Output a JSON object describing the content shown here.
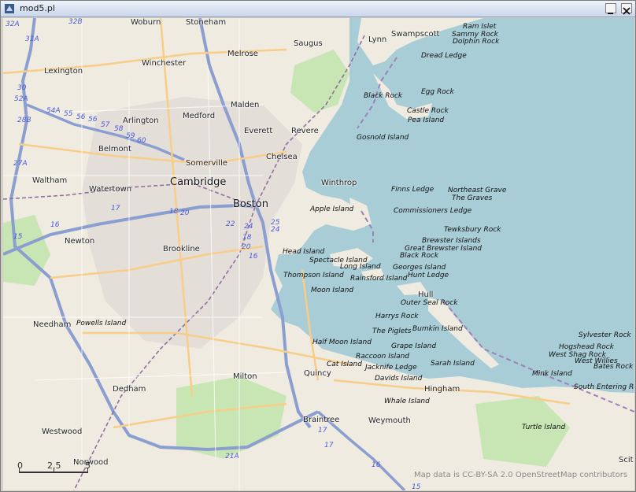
{
  "window": {
    "title": "mod5.pl"
  },
  "map": {
    "colors": {
      "water": "#a9cdd6",
      "land": "#efebe0",
      "urban": "#e2ddd8",
      "park": "#c8e6b4",
      "road": "#f7cd87",
      "highway": "#8b9ed0",
      "rail": "#8f6fa0"
    },
    "towns": [
      {
        "label": "Woburn"
      },
      {
        "label": "Stoneham"
      },
      {
        "label": "Lexington"
      },
      {
        "label": "Winchester"
      },
      {
        "label": "Melrose"
      },
      {
        "label": "Saugus"
      },
      {
        "label": "Lynn"
      },
      {
        "label": "Swampscott"
      },
      {
        "label": "Malden"
      },
      {
        "label": "Medford"
      },
      {
        "label": "Arlington"
      },
      {
        "label": "Everett"
      },
      {
        "label": "Revere"
      },
      {
        "label": "Belmont"
      },
      {
        "label": "Chelsea"
      },
      {
        "label": "Somerville"
      },
      {
        "label": "Waltham"
      },
      {
        "label": "Watertown"
      },
      {
        "label": "Winthrop"
      },
      {
        "label": "Newton"
      },
      {
        "label": "Brookline"
      },
      {
        "label": "Needham"
      },
      {
        "label": "Milton"
      },
      {
        "label": "Quincy"
      },
      {
        "label": "Hull"
      },
      {
        "label": "Dedham"
      },
      {
        "label": "Hingham"
      },
      {
        "label": "Braintree"
      },
      {
        "label": "Weymouth"
      },
      {
        "label": "Westwood"
      },
      {
        "label": "Norwood"
      },
      {
        "label": "Scit"
      }
    ],
    "major_towns": [
      {
        "label": "Cambridge"
      },
      {
        "label": "Boston"
      }
    ],
    "water_features": [
      {
        "label": "Ram Islet"
      },
      {
        "label": "Sammy Rock"
      },
      {
        "label": "Dolphin Rock"
      },
      {
        "label": "Dread Ledge"
      },
      {
        "label": "Egg Rock"
      },
      {
        "label": "Black Rock"
      },
      {
        "label": "Castle Rock"
      },
      {
        "label": "Pea Island"
      },
      {
        "label": "Gosnold Island"
      },
      {
        "label": "Finns Ledge"
      },
      {
        "label": "Northeast Grave"
      },
      {
        "label": "The Graves"
      },
      {
        "label": "Apple Island"
      },
      {
        "label": "Commissioners Ledge"
      },
      {
        "label": "Tewksbury Rock"
      },
      {
        "label": "Brewster Islands"
      },
      {
        "label": "Great Brewster Island"
      },
      {
        "label": "Head Island"
      },
      {
        "label": "Black Rock"
      },
      {
        "label": "Spectacle Island"
      },
      {
        "label": "Long Island"
      },
      {
        "label": "Georges Island"
      },
      {
        "label": "Thompson Island"
      },
      {
        "label": "Rainsford Island"
      },
      {
        "label": "Hunt Ledge"
      },
      {
        "label": "Moon Island"
      },
      {
        "label": "Outer Seal Rock"
      },
      {
        "label": "Harrys Rock"
      },
      {
        "label": "Powells Island"
      },
      {
        "label": "Bumkin Island"
      },
      {
        "label": "The Piglets"
      },
      {
        "label": "Sylvester Rock"
      },
      {
        "label": "Half Moon Island"
      },
      {
        "label": "Grape Island"
      },
      {
        "label": "Hogshead Rock"
      },
      {
        "label": "West Shag Rock"
      },
      {
        "label": "West Willies"
      },
      {
        "label": "Raccoon Island"
      },
      {
        "label": "Bates Rock"
      },
      {
        "label": "Cat Island"
      },
      {
        "label": "Jacknife Ledge"
      },
      {
        "label": "Sarah Island"
      },
      {
        "label": "Mink Island"
      },
      {
        "label": "Davids Island"
      },
      {
        "label": "South Entering Roc"
      },
      {
        "label": "Whale Island"
      },
      {
        "label": "Turtle Island"
      }
    ],
    "routes": [
      {
        "label": "32B"
      },
      {
        "label": "32A"
      },
      {
        "label": "31A"
      },
      {
        "label": "30"
      },
      {
        "label": "52A"
      },
      {
        "label": "28B"
      },
      {
        "label": "54A"
      },
      {
        "label": "55"
      },
      {
        "label": "56"
      },
      {
        "label": "56"
      },
      {
        "label": "57"
      },
      {
        "label": "58"
      },
      {
        "label": "59"
      },
      {
        "label": "60"
      },
      {
        "label": "27A"
      },
      {
        "label": "17"
      },
      {
        "label": "18"
      },
      {
        "label": "20"
      },
      {
        "label": "22"
      },
      {
        "label": "24"
      },
      {
        "label": "25"
      },
      {
        "label": "24"
      },
      {
        "label": "18"
      },
      {
        "label": "20"
      },
      {
        "label": "16"
      },
      {
        "label": "15"
      },
      {
        "label": "16"
      },
      {
        "label": "17"
      },
      {
        "label": "17"
      },
      {
        "label": "21A"
      },
      {
        "label": "16"
      },
      {
        "label": "15"
      }
    ],
    "scale": {
      "labels": [
        "0",
        "2.5",
        "5"
      ]
    },
    "attribution": "Map data is CC-BY-SA 2.0 OpenStreetMap contributors"
  }
}
